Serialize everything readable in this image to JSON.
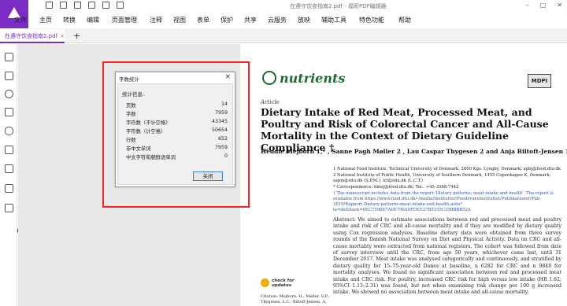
{
  "app": {
    "window_title": "在遵守饮食指南2.pdf - 福昕PDF编辑器",
    "brand_color": "#7b2cc4"
  },
  "menu": [
    "文件",
    "主页",
    "转换",
    "编辑",
    "页面管理",
    "注释",
    "视图",
    "表单",
    "保护",
    "共享",
    "云服务",
    "放映",
    "辅助工具",
    "特色功能",
    "帮助"
  ],
  "tabs": [
    {
      "label": "在遵守饮食指南2.pdf",
      "close": "×"
    }
  ],
  "tab_add": "+",
  "sidebar_icons": [
    "bookmark-icon",
    "page-thumbnail-icon",
    "comment-icon",
    "layer-icon",
    "attachment-icon",
    "security-icon",
    "signature-icon",
    "form-icon",
    "compare-icon"
  ],
  "dialog": {
    "title": "字数统计",
    "close": "×",
    "info_label": "统计信息:",
    "rows": [
      {
        "k": "页数",
        "v": "14"
      },
      {
        "k": "字数",
        "v": "7959"
      },
      {
        "k": "字符数（不计空格）",
        "v": "43345"
      },
      {
        "k": "字符数（计空格）",
        "v": "50654"
      },
      {
        "k": "行数",
        "v": "652"
      },
      {
        "k": "非中文单词",
        "v": "7959"
      },
      {
        "k": "中文字符和朝鲜语单词",
        "v": "0"
      }
    ],
    "ok_label": "关闭"
  },
  "document": {
    "journal": "nutrients",
    "publisher": "MDPI",
    "article_type": "Article",
    "title": "Dietary Intake of Red Meat, Processed Meat, and Poultry and Risk of Colorectal Cancer and All-Cause Mortality in the Context of Dietary Guideline Compliance †",
    "authors": "Heddie Mejborn 1,* , Sanne Pagh Møller 2 , Lau Caspar Thygesen 2 and Anja Biltoft-Jensen 1",
    "affiliations": [
      "1   National Food Institute, Technical University of Denmark, 2800 Kgs. Lyngby, Denmark; apbj@food.dtu.dk",
      "2   National Institute of Public Health, University of Southern Denmark, 1455 Copenhagen K, Denmark; sapm@sdu.dk (S.P.M.); lct@sdu.dk (L.C.T.)",
      "*   Correspondence: hmej@food.dtu.dk; Tel.: +45-3588-7442",
      "†   The manuscript includes data from the report 'Dietary patterns, meat intake and health'. The report is available from https://www.food.dtu.dk/-/media/Institutter/Foedevareinstituttet/Publikationer/Pub-2019/Rapport-Dietary-patterns-meat-intake-and-health.ashx?la=da&hash=6EC7596E7A0E796A0FDEE27B5155C35BBBB52A"
    ],
    "abstract": "Abstract: We aimed to estimate associations between red and processed meat and poultry intake and risk of CRC and all-cause mortality and if they are modified by dietary quality using Cox regression analyses. Baseline dietary data were obtained from three survey rounds of the Danish National Survey on Diet and Physical Activity. Data on CRC and all-cause mortality were extracted from national registers. The cohort was followed from date of survey interview until the CRC, from age 50 years, whichever came last, until 31 December 2017. Meat intake was analysed categorically and continuously, and stratified by dietary quality for 15–75-year-old Danes at baseline, n 6282 for CRC and n 9848 for mortality analyses. We found no significant association between red and processed meat intake and CRC risk. For poultry, increased CRC risk for high versus low intake (HR 1.62; 95%CI 1.13–2.31) was found, but not when examining risk change per 100 g increased intake. We showed no association between meat intake and all-cause mortality.",
    "check_updates": [
      "check for",
      "updates"
    ],
    "citation": "Citation: Mejborn, H.; Møller, S.P.; Thygesen, L.C.; Biltoft-Jensen, A."
  }
}
